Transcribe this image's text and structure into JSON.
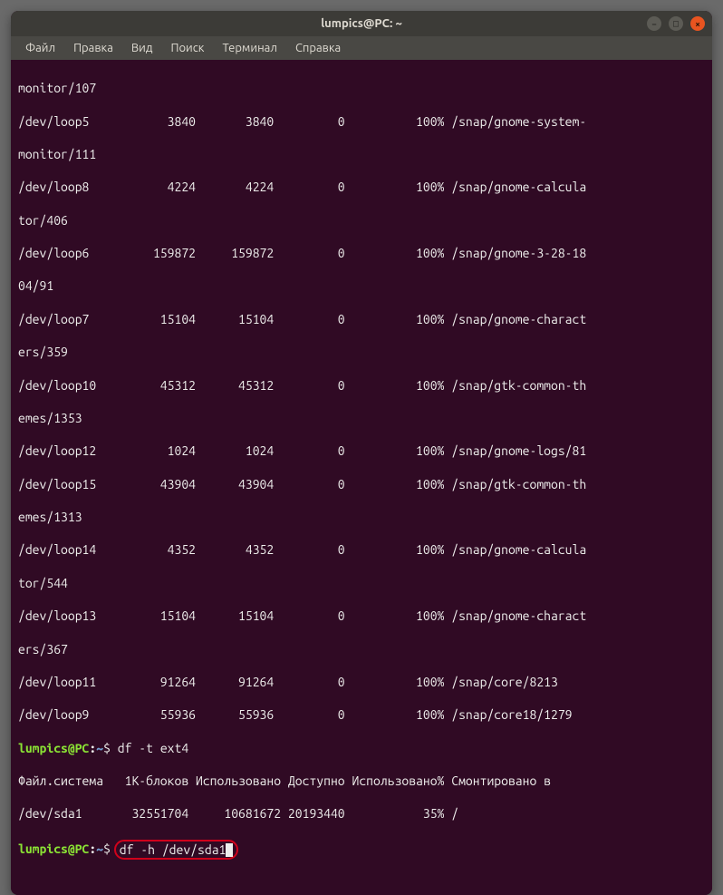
{
  "window": {
    "title": "lumpics@PC: ~"
  },
  "menu": {
    "items": [
      "Файл",
      "Правка",
      "Вид",
      "Поиск",
      "Терминал",
      "Справка"
    ]
  },
  "output": {
    "lines": [
      "monitor/107",
      "/dev/loop5           3840       3840         0          100% /snap/gnome-system-",
      "monitor/111",
      "/dev/loop8           4224       4224         0          100% /snap/gnome-calcula",
      "tor/406",
      "/dev/loop6         159872     159872         0          100% /snap/gnome-3-28-18",
      "04/91",
      "/dev/loop7          15104      15104         0          100% /snap/gnome-charact",
      "ers/359",
      "/dev/loop10         45312      45312         0          100% /snap/gtk-common-th",
      "emes/1353",
      "/dev/loop12          1024       1024         0          100% /snap/gnome-logs/81",
      "/dev/loop15         43904      43904         0          100% /snap/gtk-common-th",
      "emes/1313",
      "/dev/loop14          4352       4352         0          100% /snap/gnome-calcula",
      "tor/544",
      "/dev/loop13         15104      15104         0          100% /snap/gnome-charact",
      "ers/367",
      "/dev/loop11         91264      91264         0          100% /snap/core/8213",
      "/dev/loop9          55936      55936         0          100% /snap/core18/1279"
    ]
  },
  "prompt1": {
    "user_host": "lumpics@PC",
    "colon": ":",
    "path": "~",
    "dollar": "$ ",
    "command": "df -t ext4"
  },
  "header": {
    "text": "Файл.система   1K-блоков Использовано Доступно Использовано% Cмонтировано в"
  },
  "row1": {
    "text": "/dev/sda1       32551704     10681672 20193440           35% /"
  },
  "prompt2": {
    "user_host": "lumpics@PC",
    "colon": ":",
    "path": "~",
    "dollar": "$ ",
    "command": "df -h /dev/sda1"
  }
}
